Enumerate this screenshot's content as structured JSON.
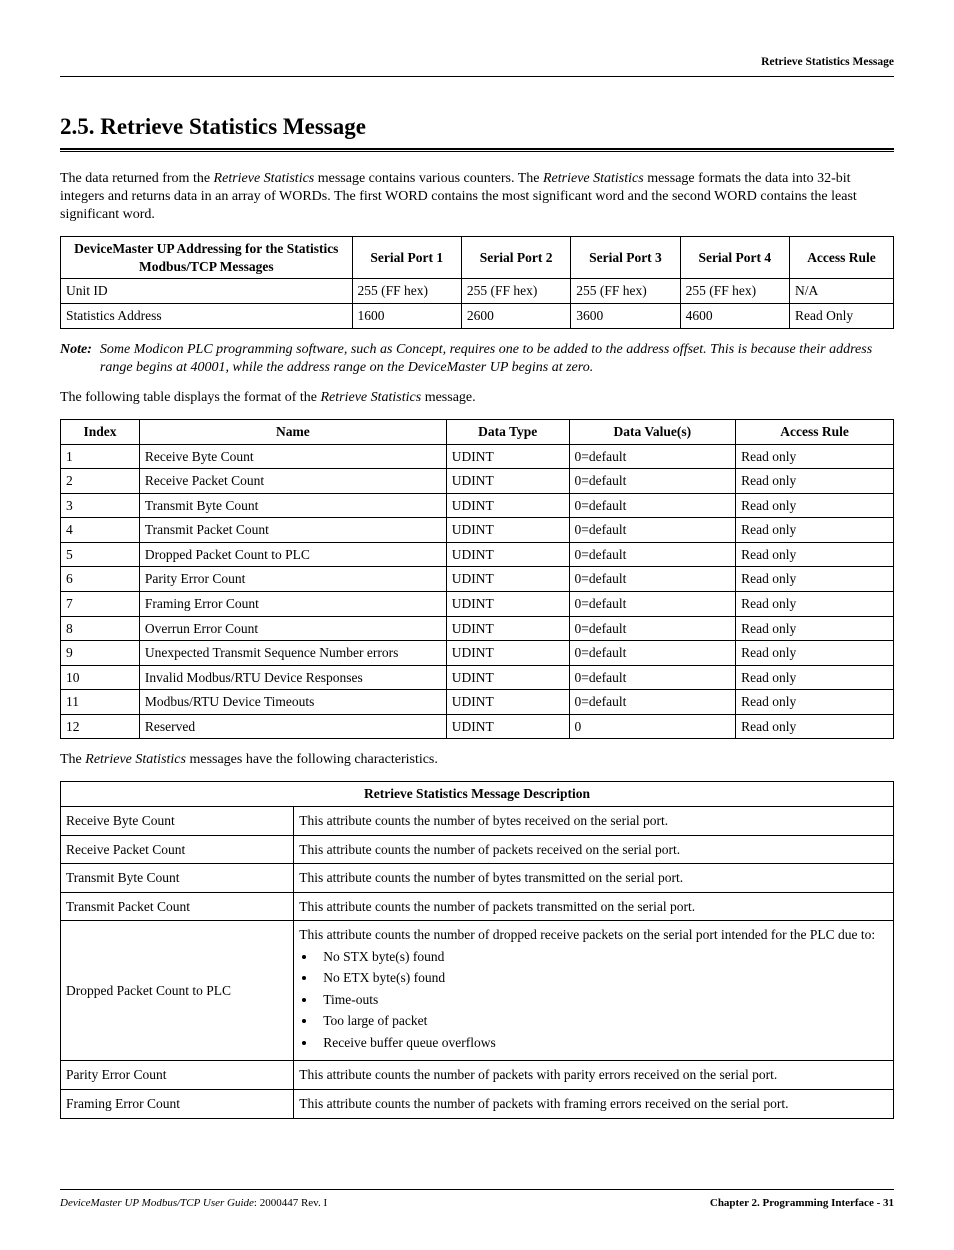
{
  "header": {
    "running_title": "Retrieve Statistics Message"
  },
  "section": {
    "number_title": "2.5. Retrieve Statistics Message",
    "intro_pre": "The data returned from the ",
    "intro_em1": "Retrieve Statistics",
    "intro_mid": " message contains various counters. The ",
    "intro_em2": "Retrieve Statistics",
    "intro_post": " message formats the data into 32-bit integers and returns data in an array of WORDs. The first WORD contains the most significant word and the second WORD contains the least significant word."
  },
  "addressing_table": {
    "headers": {
      "main": "DeviceMaster UP Addressing for the Statistics Modbus/TCP Messages",
      "p1": "Serial Port 1",
      "p2": "Serial Port 2",
      "p3": "Serial Port 3",
      "p4": "Serial Port 4",
      "access": "Access Rule"
    },
    "rows": [
      {
        "label": "Unit ID",
        "p1": "255 (FF hex)",
        "p2": "255 (FF hex)",
        "p3": "255 (FF hex)",
        "p4": "255 (FF hex)",
        "access": "N/A"
      },
      {
        "label": "Statistics Address",
        "p1": "1600",
        "p2": "2600",
        "p3": "3600",
        "p4": "4600",
        "access": "Read Only"
      }
    ]
  },
  "note": {
    "label": "Note:",
    "text": "Some Modicon PLC programming software, such as Concept, requires one to be added to the address offset. This is because their address range begins at 40001, while the address range on the DeviceMaster UP begins at zero."
  },
  "format_intro_pre": "The following table displays the format of the ",
  "format_intro_em": "Retrieve Statistics",
  "format_intro_post": " message.",
  "format_table": {
    "headers": {
      "index": "Index",
      "name": "Name",
      "dtype": "Data Type",
      "dval": "Data Value(s)",
      "access": "Access Rule"
    },
    "rows": [
      {
        "index": "1",
        "name": "Receive Byte Count",
        "dtype": "UDINT",
        "dval": "0=default",
        "access": "Read only"
      },
      {
        "index": "2",
        "name": "Receive Packet Count",
        "dtype": "UDINT",
        "dval": "0=default",
        "access": "Read only"
      },
      {
        "index": "3",
        "name": "Transmit Byte Count",
        "dtype": "UDINT",
        "dval": "0=default",
        "access": "Read only"
      },
      {
        "index": "4",
        "name": "Transmit Packet Count",
        "dtype": "UDINT",
        "dval": "0=default",
        "access": "Read only"
      },
      {
        "index": "5",
        "name": "Dropped Packet Count to PLC",
        "dtype": "UDINT",
        "dval": "0=default",
        "access": "Read only"
      },
      {
        "index": "6",
        "name": "Parity Error Count",
        "dtype": "UDINT",
        "dval": "0=default",
        "access": "Read only"
      },
      {
        "index": "7",
        "name": "Framing Error Count",
        "dtype": "UDINT",
        "dval": "0=default",
        "access": "Read only"
      },
      {
        "index": "8",
        "name": "Overrun Error Count",
        "dtype": "UDINT",
        "dval": "0=default",
        "access": "Read only"
      },
      {
        "index": "9",
        "name": "Unexpected Transmit Sequence Number errors",
        "dtype": "UDINT",
        "dval": "0=default",
        "access": "Read only"
      },
      {
        "index": "10",
        "name": "Invalid Modbus/RTU Device Responses",
        "dtype": "UDINT",
        "dval": "0=default",
        "access": "Read only"
      },
      {
        "index": "11",
        "name": "Modbus/RTU Device Timeouts",
        "dtype": "UDINT",
        "dval": "0=default",
        "access": "Read only"
      },
      {
        "index": "12",
        "name": "Reserved",
        "dtype": "UDINT",
        "dval": "0",
        "access": "Read only"
      }
    ]
  },
  "char_intro_pre": "The ",
  "char_intro_em": "Retrieve Statistics",
  "char_intro_post": " messages have the following characteristics.",
  "desc_table": {
    "header": "Retrieve Statistics Message Description",
    "rows": [
      {
        "name": "Receive Byte Count",
        "desc": "This attribute counts the number of bytes received on the serial port."
      },
      {
        "name": "Receive Packet Count",
        "desc": "This attribute counts the number of packets received on the serial port."
      },
      {
        "name": "Transmit Byte Count",
        "desc": "This attribute counts the number of bytes transmitted on the serial port."
      },
      {
        "name": "Transmit Packet Count",
        "desc": "This attribute counts the number of packets transmitted on the serial port."
      }
    ],
    "dropped": {
      "name": "Dropped Packet Count to PLC",
      "intro": "This attribute counts the number of dropped receive packets on the serial port intended for the PLC due to:",
      "bullets": [
        "No STX byte(s) found",
        "No ETX byte(s) found",
        "Time-outs",
        "Too large of packet",
        "Receive buffer queue overflows"
      ]
    },
    "rows2": [
      {
        "name": "Parity Error Count",
        "desc": "This attribute counts the number of packets with parity errors received on the serial port."
      },
      {
        "name": "Framing Error Count",
        "desc": "This attribute counts the number of packets with framing errors received on the serial port."
      }
    ]
  },
  "footer": {
    "left_em": "DeviceMaster UP Modbus/TCP User Guide",
    "left_rest": ": 2000447 Rev. I",
    "right": "Chapter 2. Programming Interface - 31"
  }
}
